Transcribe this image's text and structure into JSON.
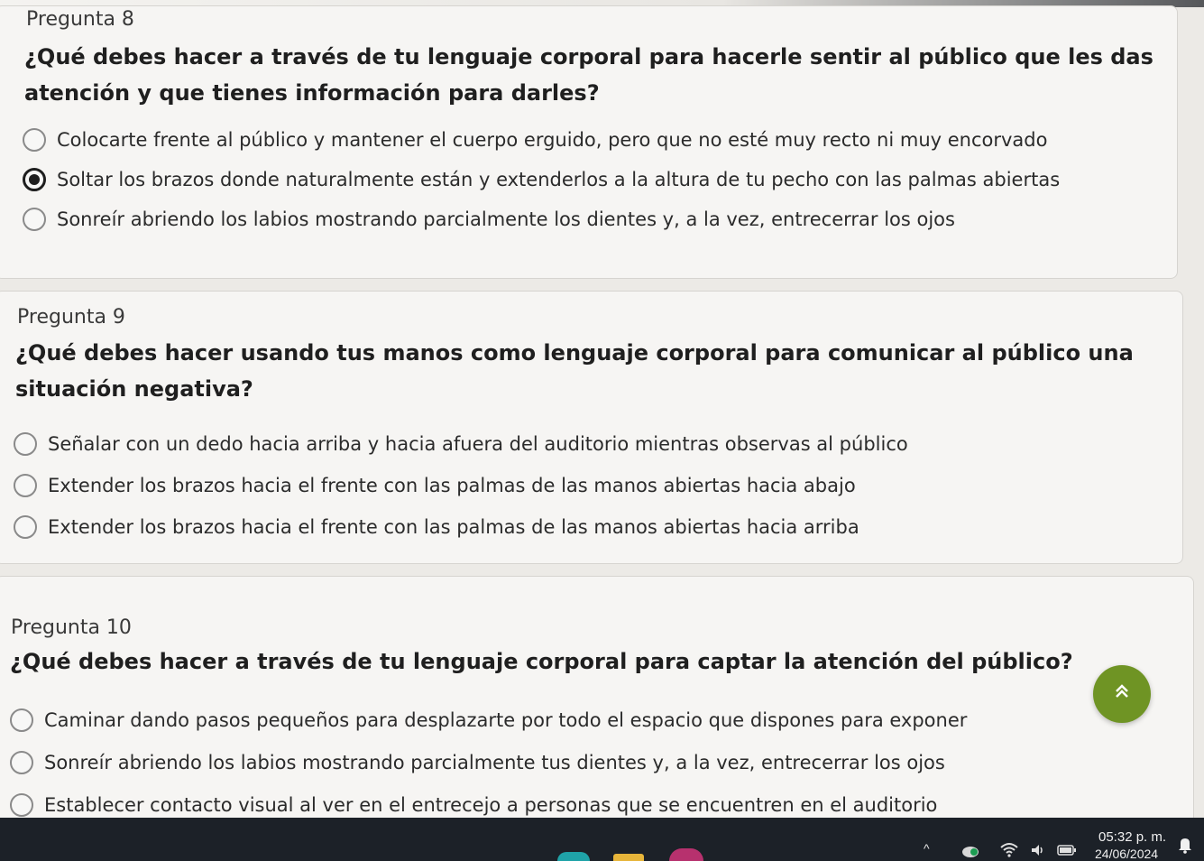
{
  "questions": [
    {
      "number_label": "Pregunta 8",
      "text": "¿Qué debes hacer a través de tu lenguaje corporal para hacerle sentir al público que les das atención y que tienes información para darles?",
      "options": [
        {
          "label": "Colocarte frente al público y mantener el cuerpo erguido, pero que no esté muy recto ni muy encorvado",
          "selected": false
        },
        {
          "label": "Soltar los brazos donde naturalmente están y extenderlos a la altura de tu pecho con las palmas abiertas",
          "selected": true
        },
        {
          "label": "Sonreír abriendo los labios mostrando parcialmente los dientes y, a la vez, entrecerrar los ojos",
          "selected": false
        }
      ]
    },
    {
      "number_label": "Pregunta 9",
      "text": "¿Qué debes hacer usando tus manos como lenguaje corporal para comunicar al público una situación negativa?",
      "options": [
        {
          "label": "Señalar con un dedo hacia arriba y hacia afuera del auditorio mientras observas al público",
          "selected": false
        },
        {
          "label": "Extender los brazos hacia el frente con las palmas de las manos abiertas hacia abajo",
          "selected": false
        },
        {
          "label": "Extender los brazos hacia el frente con las palmas de las manos abiertas hacia arriba",
          "selected": false
        }
      ]
    },
    {
      "number_label": "Pregunta 10",
      "text": "¿Qué debes hacer a través de tu lenguaje corporal para captar la atención del público?",
      "options": [
        {
          "label": "Caminar dando pasos pequeños para desplazarte por todo el espacio que dispones para exponer",
          "selected": false
        },
        {
          "label": "Sonreír abriendo los labios mostrando parcialmente tus dientes y, a la vez, entrecerrar los ojos",
          "selected": false
        },
        {
          "label": "Establecer contacto visual al ver en el entrecejo a personas que se encuentren en el auditorio",
          "selected": false
        }
      ]
    }
  ],
  "scroll_top_button": {
    "icon": "double-chevron-up-icon",
    "glyph": "⌃",
    "color": "#6f9424"
  },
  "taskbar": {
    "clock_time": "05:32 p. m.",
    "clock_date": "24/06/2024",
    "tray_icons": [
      "chevron-up-icon",
      "app-icon",
      "wifi-icon",
      "volume-icon",
      "battery-icon",
      "notification-icon"
    ],
    "chevron_glyph": "^"
  }
}
